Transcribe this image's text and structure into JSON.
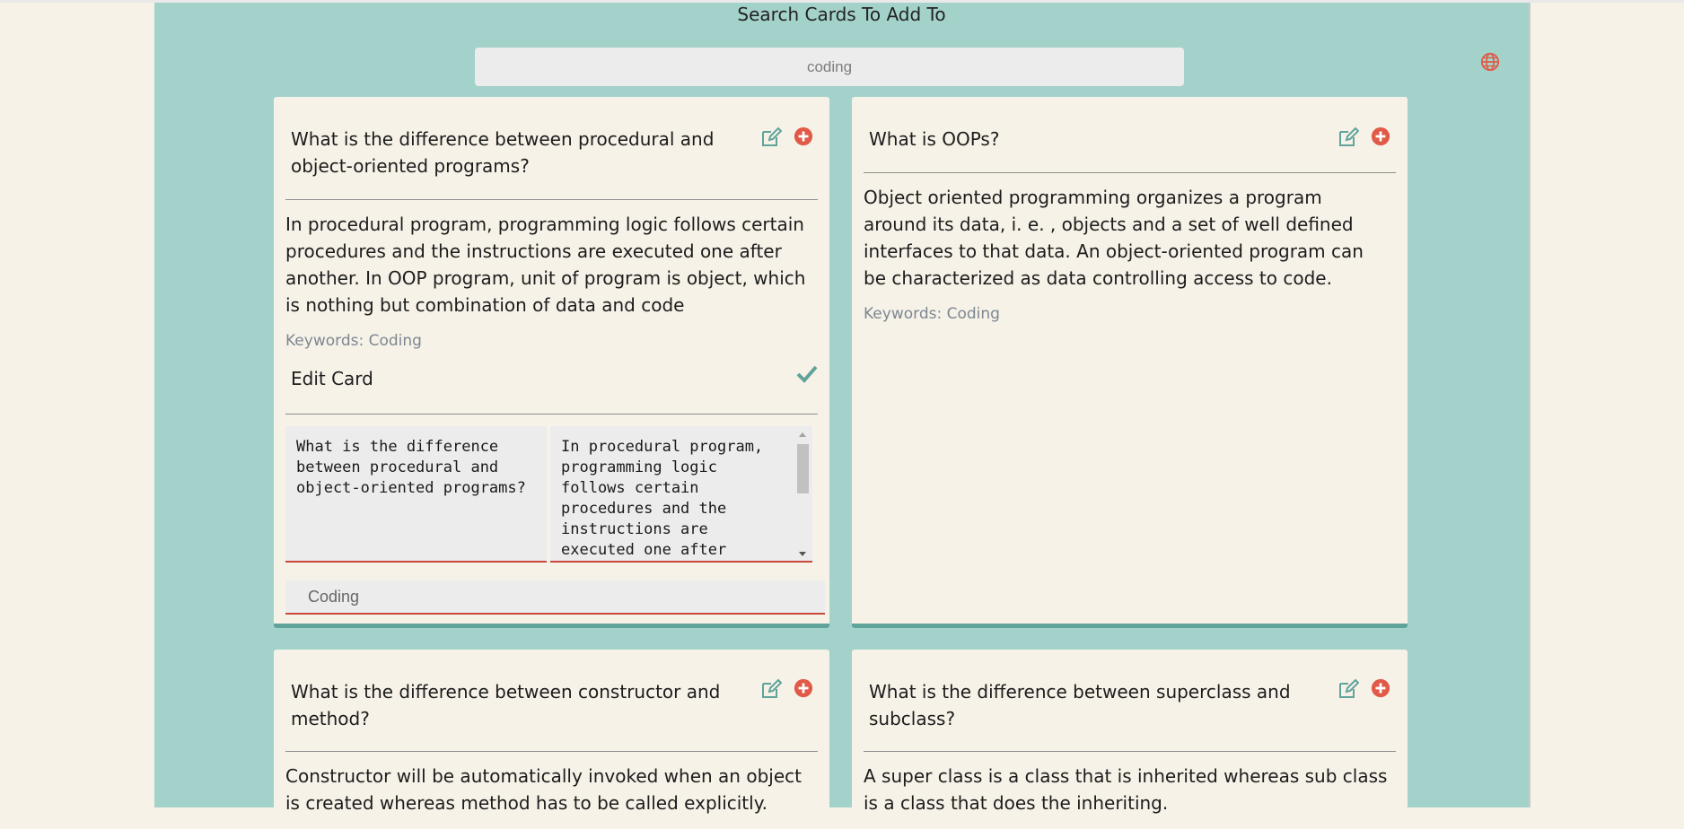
{
  "header": {
    "title": "Search Cards To Add To",
    "search_value": "coding",
    "globe_icon": "globe-icon"
  },
  "colors": {
    "panel": "#a3d2cb",
    "card": "#f7f2e8",
    "accent_teal": "#5fa39b",
    "add_red": "#e05a47",
    "underline_red": "#c9473d"
  },
  "cards": [
    {
      "question": "What is the difference between procedural and object-oriented programs?",
      "answer": "In procedural program, programming logic follows certain procedures and the instructions are executed one after another. In OOP program, unit of program is object, which is nothing but combination of data and code",
      "keywords": "Keywords: Coding",
      "edit": {
        "title": "Edit Card",
        "question_value": "What is the difference between procedural and object-oriented programs?",
        "answer_value": "In procedural program, programming logic follows certain procedures and the instructions are executed one after another. In OOP program, unit of program is object, which is nothing but combination of data and code",
        "keywords_value": "Coding"
      }
    },
    {
      "question": "What is OOPs?",
      "answer": "Object oriented programming organizes a program around its data, i. e. , objects and a set of well defined interfaces to that data. An object-oriented program can be characterized as data controlling access to code.",
      "keywords": "Keywords: Coding"
    },
    {
      "question": "What is the difference between constructor and method?",
      "answer": "Constructor will be automatically invoked when an object is created whereas method has to be called explicitly."
    },
    {
      "question": "What is the difference between superclass and subclass?",
      "answer": "A super class is a class that is inherited whereas sub class is a class that does the inheriting."
    }
  ]
}
